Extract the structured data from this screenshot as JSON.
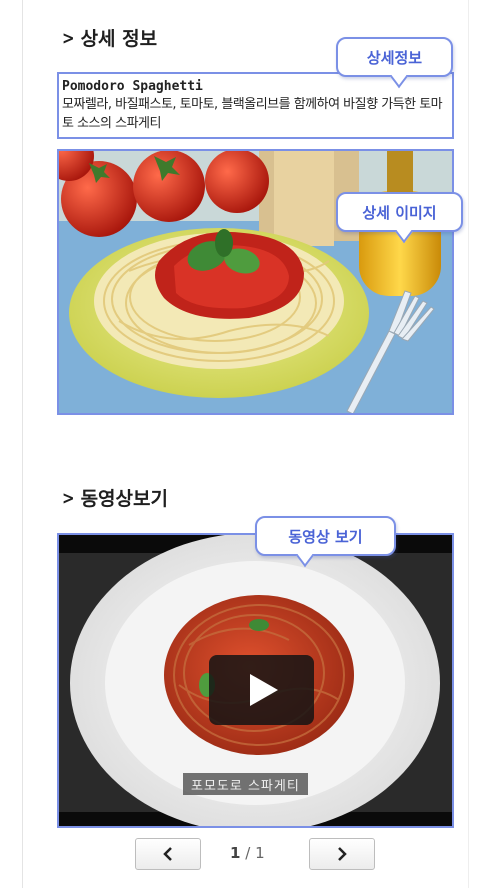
{
  "detail_section": {
    "title": "상세 정보",
    "callout_info": "상세정보",
    "callout_image": "상세 이미지",
    "product_name": "Pomodoro Spaghetti",
    "description": "모짜렐라, 바질패스토, 토마토, 블랙올리브를 함께하여 바질향 가득한 토마토 소스의 스파게티"
  },
  "video_section": {
    "title": "동영상보기",
    "callout": "동영상 보기",
    "caption": "포모도로 스파게티"
  },
  "pager": {
    "current": "1",
    "separator": "/",
    "total": "1",
    "prev_icon": "chevron-left-icon",
    "next_icon": "chevron-right-icon"
  },
  "icons": {
    "section_marker": "chevron-right-icon",
    "play": "play-icon"
  },
  "colors": {
    "highlight": "#7b90e6",
    "callout_text": "#4a63d6"
  }
}
